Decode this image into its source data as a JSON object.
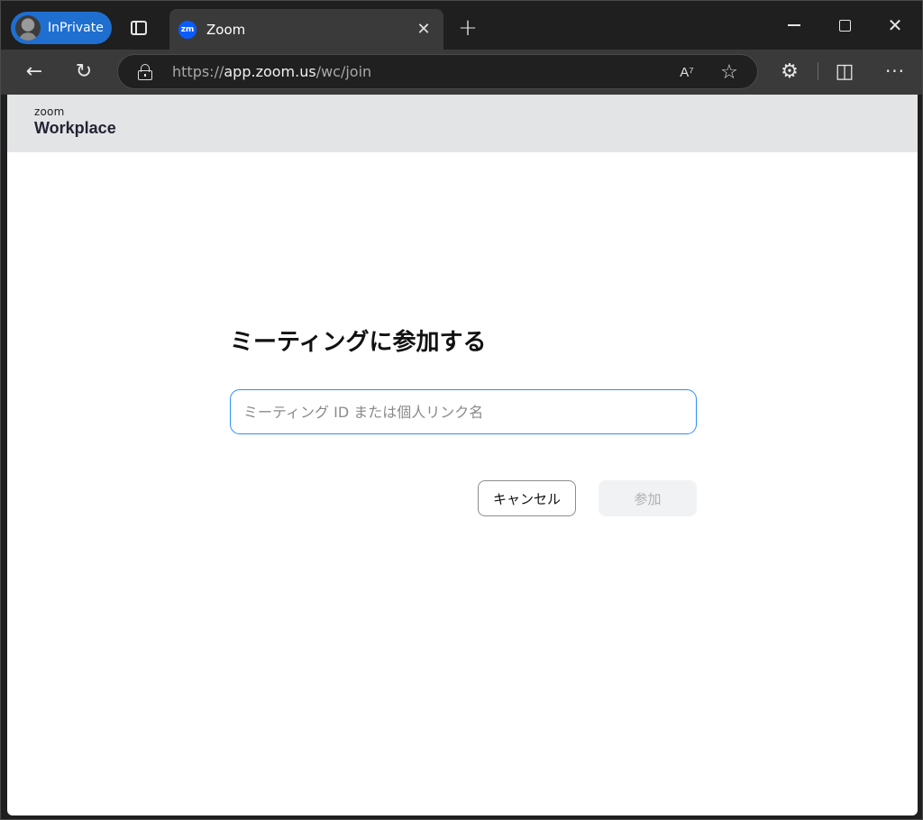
{
  "browser": {
    "profile_label": "InPrivate",
    "tab": {
      "title": "Zoom",
      "favicon_text": "zm",
      "close_glyph": "✕"
    },
    "new_tab_glyph": "+",
    "address": {
      "scheme": "https://",
      "host": "app.zoom.us",
      "path": "/wc/join"
    },
    "read_aloud_glyph": "A⁷",
    "favorite_glyph": "☆",
    "extensions_glyph": "⚙",
    "split_glyph": "◫",
    "more_glyph": "···",
    "back_glyph": "←",
    "reload_glyph": "↻",
    "close_glyph": "✕"
  },
  "page": {
    "logo_small": "zoom",
    "logo_large": "Workplace",
    "title": "ミーティングに参加する",
    "input": {
      "value": "",
      "placeholder": "ミーティング ID または個人リンク名"
    },
    "cancel_label": "キャンセル",
    "join_label": "参加"
  },
  "colors": {
    "accent": "#2d8cff",
    "profile_pill": "#1f6fd0",
    "zoom_brand": "#0b5cff",
    "header_bg": "#e2e4e6"
  },
  "icons": [
    "tabs-icon",
    "back-icon",
    "reload-icon",
    "lock-icon",
    "read-aloud-icon",
    "favorite-star-icon",
    "extensions-icon",
    "split-screen-icon",
    "more-icon",
    "minimize-icon",
    "maximize-icon",
    "close-icon"
  ]
}
